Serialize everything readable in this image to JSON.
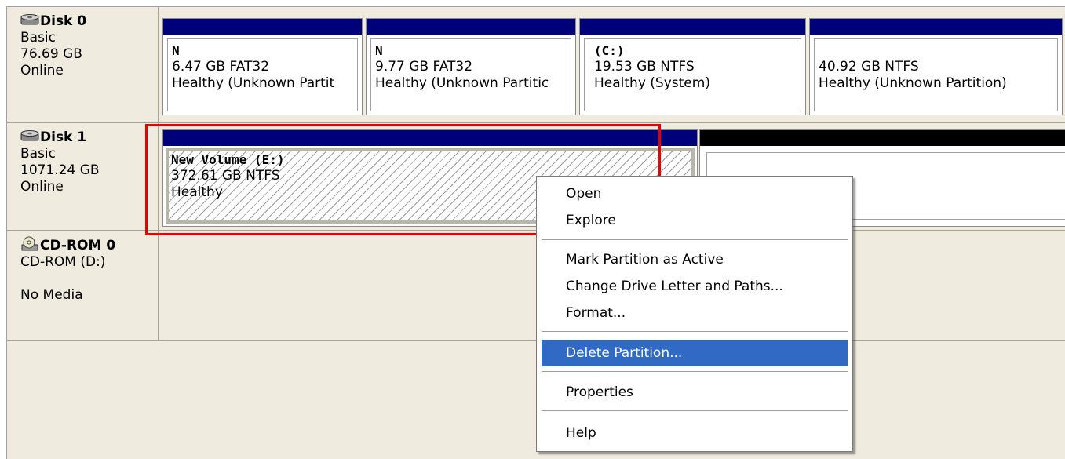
{
  "disks": [
    {
      "name": "Disk 0",
      "icon": "disk-icon",
      "type": "Basic",
      "size": "76.69 GB",
      "status": "Online",
      "partitions": [
        {
          "label": "N",
          "size_fs": "6.47 GB FAT32",
          "status": "Healthy (Unknown Partit"
        },
        {
          "label": "N",
          "size_fs": "9.77 GB FAT32",
          "status": "Healthy (Unknown Partitic"
        },
        {
          "label": "(C:)",
          "size_fs": "19.53 GB NTFS",
          "status": "Healthy (System)"
        },
        {
          "label": "",
          "size_fs": "40.92 GB NTFS",
          "status": "Healthy (Unknown Partition)"
        }
      ]
    },
    {
      "name": "Disk 1",
      "icon": "disk-icon",
      "type": "Basic",
      "size": "1071.24 GB",
      "status": "Online",
      "partitions": [
        {
          "label": "New Volume  (E:)",
          "size_fs": "372.61 GB NTFS",
          "status": "Healthy"
        }
      ]
    },
    {
      "name": "CD-ROM 0",
      "icon": "cdrom-icon",
      "type": "CD-ROM (D:)",
      "size": "",
      "status": "No Media"
    }
  ],
  "context_menu": {
    "items": [
      {
        "label": "Open"
      },
      {
        "label": "Explore"
      },
      {
        "label": "Mark Partition as Active"
      },
      {
        "label": "Change Drive Letter and Paths..."
      },
      {
        "label": "Format..."
      },
      {
        "label": "Delete Partition...",
        "highlighted": true
      },
      {
        "label": "Properties"
      },
      {
        "label": "Help"
      }
    ]
  },
  "colors": {
    "panel_bg": "#efebde",
    "primary_partition_bar": "#00007b",
    "unallocated_bar": "#000000",
    "menu_highlight": "#316ac5",
    "annotation_box": "#e60000"
  }
}
